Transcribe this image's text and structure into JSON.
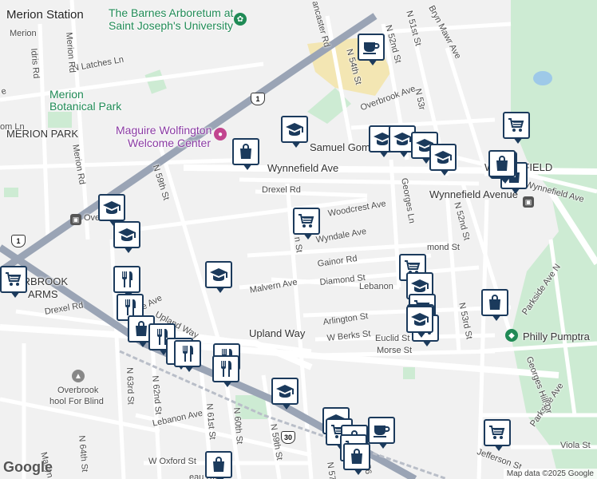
{
  "map": {
    "attribution": "Map data ©2025 Google",
    "logo": "Google",
    "colors": {
      "land": "#f1f1f1",
      "park": "#cdebd3",
      "water": "#9ec9e8",
      "highway": "#9aa4b5",
      "road": "#ffffff",
      "campus": "#f3e6b3",
      "marker_border": "#1b3a5c"
    }
  },
  "places": {
    "merion_station": "Merion Station",
    "merion": "Merion",
    "barnes_line1": "The Barnes Arboretum at",
    "barnes_line2": "Saint Joseph's University",
    "merion_botanical_1": "Merion",
    "merion_botanical_2": "Botanical Park",
    "merion_park": "MERION PARK",
    "maguire_1": "Maguire Wolfington",
    "maguire_2": "Welcome Center",
    "samuel": "Samuel Gom",
    "overbrook": "Overbrook",
    "overbrook_farms_1": "ERBROOK",
    "overbrook_farms_2": "ARMS",
    "wynnefield": "WYNNEFIELD",
    "wynnefield_ave_station": "Wynnefield Avenue",
    "philly": "Philly Pumptra",
    "overbrook_school_1": "Overbrook",
    "overbrook_school_2": "hool For Blind"
  },
  "streets": {
    "n_latches": "N Latches Ln",
    "idris": "Idris Rd",
    "merion_rd": "Merion Rd",
    "merion_rd2": "Merion Rd",
    "lancaster": "ancaster Rd",
    "n_54th": "N 54th St",
    "n_52nd": "N 52nd St",
    "n_51st": "N 51st St",
    "bryn_mawr": "Bryn Mawr Ave",
    "overbrook_ave": "Overbrook Ave",
    "wynnefield_ave": "Wynnefield Ave",
    "wynnefield_ave2": "Wynnefield Ave",
    "n_59th": "N 59th St",
    "drexel_rd": "Drexel Rd",
    "drexel_rd2": "Drexel Rd",
    "woodcrest": "Woodcrest Ave",
    "wyndale": "Wyndale Ave",
    "gainor": "Gainor Rd",
    "diamond": "Diamond St",
    "lebanon": "Lebanon",
    "lebanon_ave": "Lebanon Ave",
    "georges_ln": "Georges Ln",
    "n_52nd2": "N 52nd St",
    "n_53rd": "N 53rd St",
    "n_53rd_top": "N 53r",
    "parkside": "Parkside Ave N",
    "parkside2": "Parkside Ave",
    "malvern": "Malvern Ave",
    "upland": "Upland Way",
    "upland2": "Upland Way",
    "arlington": "Arlington St",
    "berks": "W Berks St",
    "euclid": "Euclid St",
    "morse": "Morse St",
    "n_63rd": "N 63rd St",
    "n_62nd": "N 62nd St",
    "n_61st": "N 61st St",
    "n_60th": "N 60th St",
    "n_59th2": "N 59th St",
    "n_64th": "N 64th St",
    "marlyn": "Marlyn Rd",
    "w_oxford": "W Oxford St",
    "jefferson": "Jefferson St",
    "viola": "Viola St",
    "georges_hill": "Georges Hill Dr",
    "n_th": "n St",
    "n_56": "N 56",
    "n_57": "N 57",
    "gom_ave": "Ave",
    "mond": "mond St",
    "n_lane": "ne Ave",
    "om_ln": "om Ln",
    "dr": "Dr",
    "e_l": "e",
    "n_65": "N 65",
    "rau": "eau Rd"
  },
  "shields": {
    "us1_a": "1",
    "us1_b": "1",
    "us30": "30"
  },
  "markers": [
    {
      "type": "coffee-icon"
    },
    {
      "type": "school-icon"
    },
    {
      "type": "shopping-bag-icon"
    },
    {
      "type": "grocery-cart-icon"
    },
    {
      "type": "school-icon"
    },
    {
      "type": "school-icon"
    },
    {
      "type": "school-icon"
    },
    {
      "type": "grocery-cart-icon"
    },
    {
      "type": "school-icon"
    },
    {
      "type": "shopping-bag-icon"
    },
    {
      "type": "grocery-cart-icon"
    },
    {
      "type": "school-icon"
    },
    {
      "type": "school-icon"
    },
    {
      "type": "grocery-cart-icon"
    },
    {
      "type": "grocery-cart-icon"
    },
    {
      "type": "school-icon"
    },
    {
      "type": "restaurant-icon"
    },
    {
      "type": "restaurant-icon"
    },
    {
      "type": "shopping-bag-icon"
    },
    {
      "type": "restaurant-icon"
    },
    {
      "type": "restaurant-icon"
    },
    {
      "type": "restaurant-icon"
    },
    {
      "type": "restaurant-icon"
    },
    {
      "type": "restaurant-icon"
    },
    {
      "type": "school-icon"
    },
    {
      "type": "shopping-bag-icon"
    },
    {
      "type": "school-icon"
    },
    {
      "type": "grocery-cart-icon"
    },
    {
      "type": "grocery-cart-icon"
    },
    {
      "type": "grocery-cart-icon"
    },
    {
      "type": "shopping-bag-icon"
    },
    {
      "type": "coffee-icon"
    },
    {
      "type": "school-icon"
    },
    {
      "type": "grocery-cart-icon"
    },
    {
      "type": "shopping-bag-icon"
    },
    {
      "type": "grocery-cart-icon"
    },
    {
      "type": "grocery-cart-icon"
    },
    {
      "type": "school-icon"
    },
    {
      "type": "shopping-bag-icon"
    },
    {
      "type": "shopping-bag-icon"
    }
  ]
}
